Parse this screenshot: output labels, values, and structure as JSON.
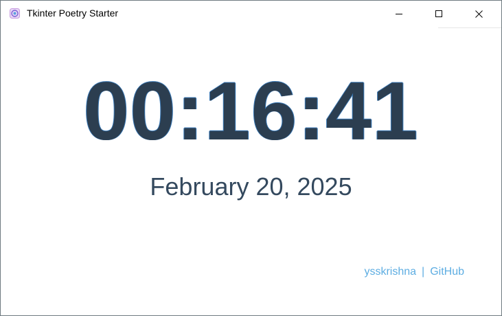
{
  "window": {
    "title": "Tkinter Poetry Starter",
    "icon": "app-icon",
    "controls": [
      "minimize-icon",
      "maximize-icon",
      "close-icon"
    ]
  },
  "clock": {
    "time": "00:16:41",
    "date": "February 20, 2025"
  },
  "footer": {
    "author_link": "ysskrishna",
    "separator": "|",
    "github_link": "GitHub"
  },
  "colors": {
    "clock_text": "#2c3e50",
    "date_text": "#34495e",
    "link": "#5dade2",
    "background": "#ffffff"
  }
}
